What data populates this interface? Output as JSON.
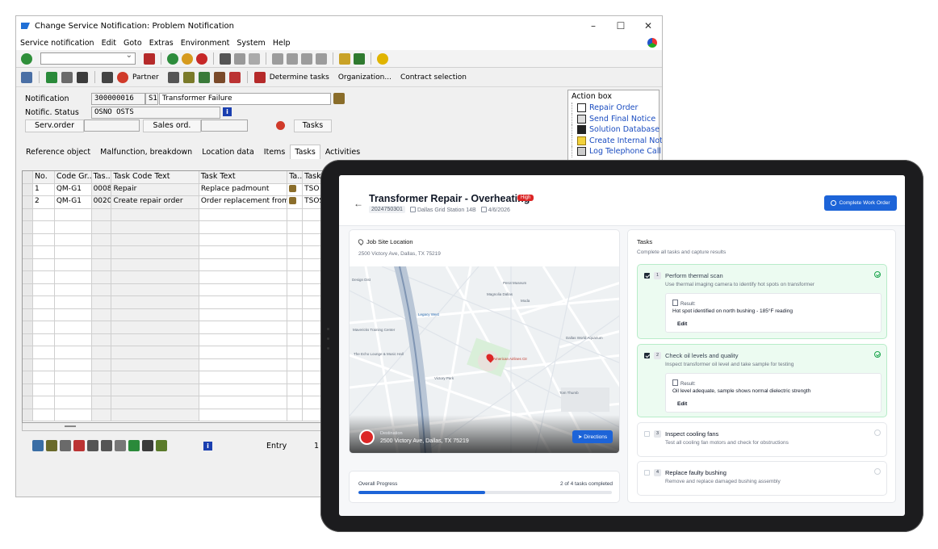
{
  "sap": {
    "title": "Change Service Notification: Problem Notification",
    "menu": [
      "Service notification",
      "Edit",
      "Goto",
      "Extras",
      "Environment",
      "System",
      "Help"
    ],
    "app_toolbar": {
      "partner": "Partner",
      "determine_tasks": "Determine tasks",
      "organization": "Organization...",
      "contract": "Contract selection"
    },
    "form": {
      "notification_label": "Notification",
      "notification_value": "300000016",
      "notification_type": "S1",
      "short_text": "Transformer Failure",
      "status_label": "Notific. Status",
      "status_value": "OSNO OSTS",
      "serv_order_label": "Serv.order",
      "sales_order_label": "Sales ord.",
      "tasks_label": "Tasks"
    },
    "tabs": [
      "Reference object",
      "Malfunction, breakdown",
      "Location data",
      "Items",
      "Tasks",
      "Activities"
    ],
    "active_tab": "Tasks",
    "grid_headers": [
      "No.",
      "Code Gr...",
      "Tas...",
      "Task Code Text",
      "Task Text",
      "Ta...",
      "Task"
    ],
    "grid_rows": [
      [
        "1",
        "QM-G1",
        "0008",
        "Repair",
        "Replace padmount",
        "",
        "TSO"
      ],
      [
        "2",
        "QM-G1",
        "0020",
        "Create repair order",
        "Order replacement from d",
        "",
        "TSOS"
      ]
    ],
    "entry_label": "Entry",
    "entry_value": "1",
    "action_box": {
      "title": "Action box",
      "items": [
        "Repair Order",
        "Send Final Notice",
        "Solution Database",
        "Create Internal Note",
        "Log Telephone Call"
      ]
    }
  },
  "app": {
    "title": "Transformer Repair - Overheating",
    "priority": "High",
    "wo_id": "2024750301",
    "station": "Dallas Grid Station 14B",
    "date": "4/6/2026",
    "complete_button": "Complete Work Order",
    "location": {
      "title": "Job Site Location",
      "address": "2500 Victory Ave, Dallas, TX 75219",
      "destination_label": "Destination",
      "destination_address": "2500 Victory Ave, Dallas, TX 75219",
      "directions_button": "Directions"
    },
    "map_labels": {
      "american_airlines": "American Airlines Ctr",
      "magnolia": "Magnolia Dallas",
      "moda": "Moda",
      "perot": "Perot Museum",
      "legacy": "Legacy West",
      "mavericks": "Mavericks Training Center",
      "echo": "The Echo Lounge & Music Hall",
      "victory_park": "Victory Park",
      "tom_thumb": "Tom Thumb",
      "dallas_world": "Dallas World Aquarium"
    },
    "progress": {
      "label": "Overall Progress",
      "count_text": "2 of 4 tasks completed",
      "completed": 2,
      "total": 4
    },
    "tasks": {
      "title": "Tasks",
      "subtitle": "Complete all tasks and capture results",
      "result_label": "Result:",
      "edit_label": "Edit",
      "items": [
        {
          "num": "1",
          "name": "Perform thermal scan",
          "desc": "Use thermal imaging camera to identify hot spots on transformer",
          "done": true,
          "result": "Hot spot identified on north bushing - 185°F reading"
        },
        {
          "num": "2",
          "name": "Check oil levels and quality",
          "desc": "Inspect transformer oil level and take sample for testing",
          "done": true,
          "result": "Oil level adequate, sample shows normal dielectric strength"
        },
        {
          "num": "3",
          "name": "Inspect cooling fans",
          "desc": "Test all cooling fan motors and check for obstructions",
          "done": false
        },
        {
          "num": "4",
          "name": "Replace faulty bushing",
          "desc": "Remove and replace damaged bushing assembly",
          "done": false
        }
      ]
    }
  }
}
